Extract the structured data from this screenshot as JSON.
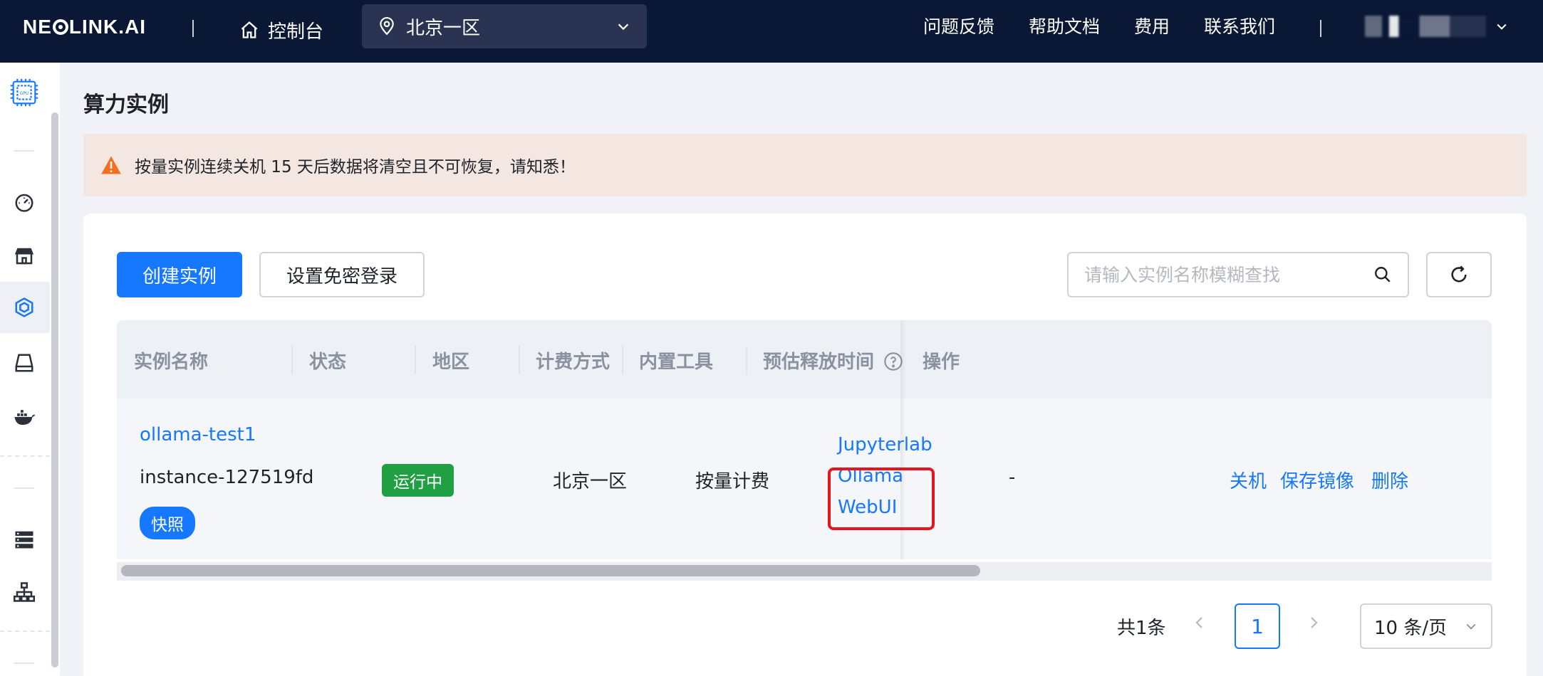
{
  "header": {
    "logo_prefix": "NE",
    "logo_suffix": "LINK.AI",
    "console_label": "控制台",
    "region_selected": "北京一区",
    "nav_links": [
      "问题反馈",
      "帮助文档",
      "费用",
      "联系我们"
    ]
  },
  "sidebar": {
    "items": [
      "gpu-icon",
      "dashboard-icon",
      "store-icon",
      "instance-icon",
      "storage-icon",
      "docker-icon",
      "server-icon",
      "network-icon"
    ]
  },
  "page": {
    "title": "算力实例",
    "alert_text": "按量实例连续关机 15 天后数据将清空且不可恢复，请知悉！"
  },
  "toolbar": {
    "create_label": "创建实例",
    "passwordless_label": "设置免密登录",
    "search_placeholder": "请输入实例名称模糊查找"
  },
  "table": {
    "headers": {
      "name": "实例名称",
      "status": "状态",
      "region": "地区",
      "billing": "计费方式",
      "tools": "内置工具",
      "release": "预估释放时间",
      "actions": "操作"
    },
    "row": {
      "name": "ollama-test1",
      "instance_id": "instance-127519fd",
      "snapshot_badge": "快照",
      "status": "运行中",
      "region": "北京一区",
      "billing": "按量计费",
      "tool_jupyter": "Jupyterlab",
      "tool_ollama_1": "Ollama",
      "tool_ollama_2": "WebUI",
      "release": "-",
      "action_shutdown": "关机",
      "action_save_image": "保存镜像",
      "action_delete": "删除"
    }
  },
  "pagination": {
    "total": "共1条",
    "current_page": "1",
    "page_size": "10 条/页"
  },
  "colors": {
    "topbar": "#0a1735",
    "primary": "#1677ff",
    "running": "#21a043",
    "highlight": "#e8141c",
    "alert_bg": "#f4e7e2"
  }
}
